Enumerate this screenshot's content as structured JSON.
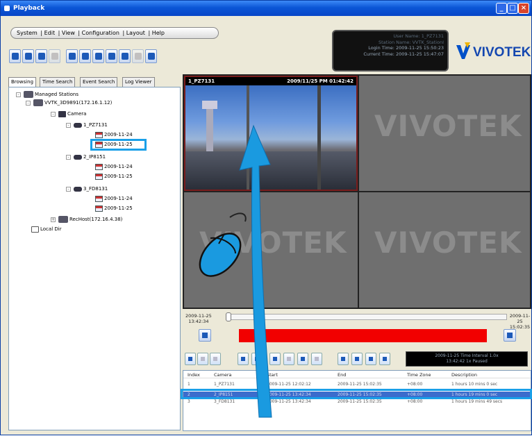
{
  "app": {
    "title": "Playback"
  },
  "menu": {
    "items": [
      "System",
      "Edit",
      "View",
      "Configuration",
      "Layout",
      "Help"
    ]
  },
  "status": {
    "user": "User Name: 1_PZ7131",
    "station": "Station Name: VVTK_StationI",
    "login": "Login Time: 2009-11-25 15:50:23",
    "current": "Current Time: 2009-11-25 15:47:07"
  },
  "logo": {
    "text": "VIVOTEK"
  },
  "tabs": [
    "Browsing",
    "Time Search",
    "Event Search",
    "Log Viewer"
  ],
  "tree": {
    "root": "Managed Stations",
    "station": "VVTK_3D9891(172.16.1.12)",
    "camera_folder": "Camera",
    "cameras": [
      {
        "name": "1_PZ7131",
        "dates": [
          "2009-11-24",
          "2009-11-25"
        ]
      },
      {
        "name": "2_IP8151",
        "dates": [
          "2009-11-24",
          "2009-11-25"
        ]
      },
      {
        "name": "3_FD8131",
        "dates": [
          "2009-11-24",
          "2009-11-25"
        ]
      }
    ],
    "recorder": "RecHost(172.16.4.38)",
    "local": "Local Dir"
  },
  "viewer": {
    "cam1_label": "1_PZ7131",
    "cam1_time": "2009/11/25 PM 01:42:42",
    "tile_logo": "VIVOTEK"
  },
  "timeline": {
    "start_date": "2009-11-25",
    "start_time": "13:42:34",
    "end_date": "2009-11-25",
    "end_time": "15:02:35",
    "position": 0.0
  },
  "playstatus": {
    "line1": "2009-11-25 Time Interval 1.0x",
    "line2": "13:42:42  1x  Paused"
  },
  "table": {
    "headers": [
      "Index",
      "Camera",
      "Start",
      "End",
      "Time Zone",
      "Description"
    ],
    "rows": [
      [
        "1",
        "1_PZ7131",
        "2009-11-25 12:02:12",
        "2009-11-25 15:02:35",
        "+08:00",
        "1 hours 10 mins 0 sec"
      ],
      [
        "2",
        "2_IP8151",
        "2009-11-25 13:42:34",
        "2009-11-25 15:02:35",
        "+08:00",
        "1 hours 19 mins 0 sec"
      ],
      [
        "3",
        "3_FD8131",
        "2009-11-25 13:42:34",
        "2009-11-25 15:02:35",
        "+08:00",
        "1 hours 19 mins 49 secs"
      ]
    ],
    "selected_index": 1
  },
  "colors": {
    "highlight": "#1aa0e8",
    "timeline_bar": "#f20000",
    "arrow": "#1a9ae0",
    "title": "#0b56d6"
  }
}
